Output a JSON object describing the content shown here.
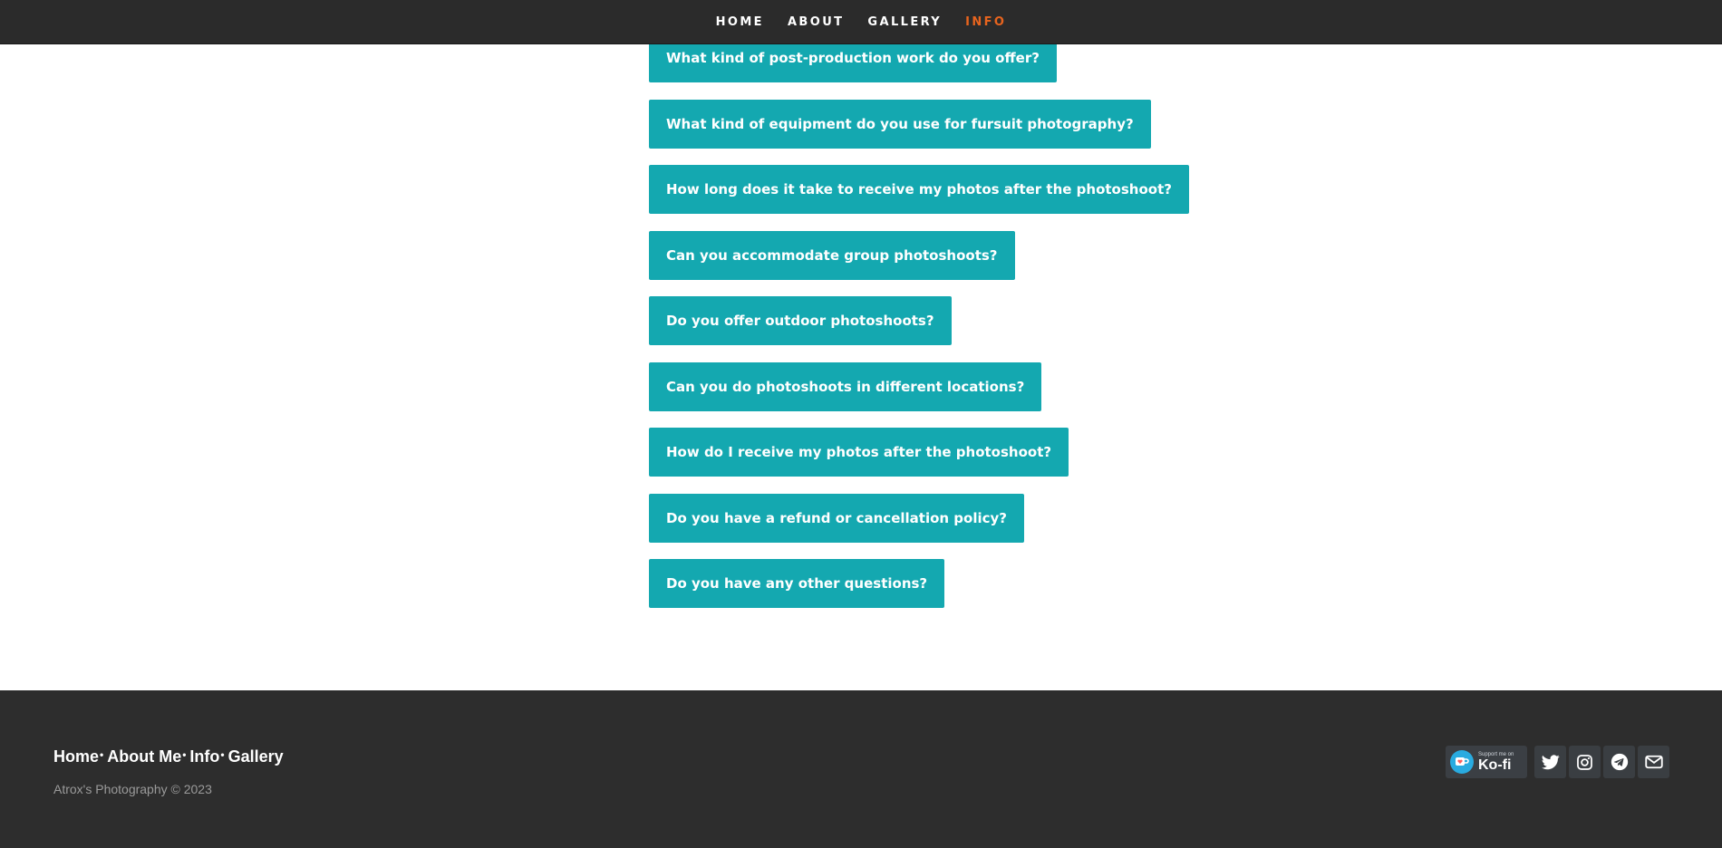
{
  "nav": {
    "items": [
      "HOME",
      "ABOUT",
      "GALLERY",
      "INFO"
    ],
    "active": "INFO"
  },
  "faq": {
    "questions": [
      "What kind of post-production work do you offer?",
      "What kind of equipment do you use for fursuit photography?",
      "How long does it take to receive my photos after the photoshoot?",
      "Can you accommodate group photoshoots?",
      "Do you offer outdoor photoshoots?",
      "Can you do photoshoots in different locations?",
      "How do I receive my photos after the photoshoot?",
      "Do you have a refund or cancellation policy?",
      "Do you have any other questions?"
    ]
  },
  "footer": {
    "links": [
      "Home",
      "About Me",
      "Info",
      "Gallery"
    ],
    "separator": "•",
    "copyright": "Atrox's Photography © 2023",
    "kofi": {
      "small": "Support me on",
      "big": "Ko-fi"
    },
    "social_icons": [
      "twitter-icon",
      "instagram-icon",
      "telegram-icon",
      "email-icon"
    ]
  },
  "colors": {
    "nav_bg": "#2b2b2b",
    "accent_active": "#e8641e",
    "button_teal": "#14a8b0",
    "footer_bg": "#2d2d2d",
    "kofi_blue": "#29abe0"
  }
}
